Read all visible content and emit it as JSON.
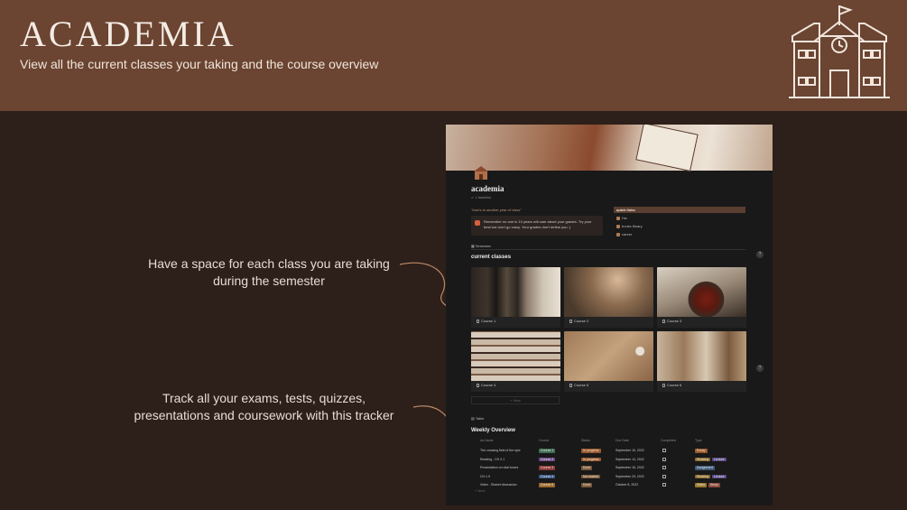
{
  "header": {
    "title": "ACADEMIA",
    "subtitle": "View all the current classes your taking and the course overview",
    "icon": "schoolhouse-icon"
  },
  "callouts": {
    "classes_line1": "Have a space for each class you are taking",
    "classes_line2": "during the semester",
    "tracker_line1": "Track all your  exams, tests, quizzes,",
    "tracker_line2": "presentations and coursework with this tracker"
  },
  "notion": {
    "page_title": "academia",
    "backlinks": "↙ 1 backlink",
    "quote": "\"how's to another year of class\"",
    "callout_text": "Remember no one in 10 years will care about your grades. Try your best but don't go crazy. Your grades don't define you :)",
    "quick_links": {
      "heading": "quick links",
      "items": [
        "Hw",
        "books library",
        "career"
      ]
    },
    "gallery_tab": "Semester",
    "current_classes_heading": "current classes",
    "help": "?",
    "classes": [
      {
        "label": "Course 1",
        "image": "books-on-shelf"
      },
      {
        "label": "Course 2",
        "image": "misty-forest-sunlight"
      },
      {
        "label": "Course 3",
        "image": "tea-and-open-book"
      },
      {
        "label": "Course 4",
        "image": "stacked-magazines"
      },
      {
        "label": "Course 5",
        "image": "pressed-flowers-paper"
      },
      {
        "label": "Course 6",
        "image": "vintage-posters"
      }
    ],
    "new_button": "+ New",
    "table_tab": "Table",
    "weekly_heading": "Weekly Overview",
    "columns": [
      "Aa Name",
      "Course",
      "Status",
      "Due Date",
      "Completed",
      "Type"
    ],
    "rows": [
      {
        "name": "The crossing field of the epic",
        "course": "Course 1",
        "course_color": "#3f6f54",
        "status": "In progress",
        "status_color": "#9a5a2e",
        "date": "September 10, 2022",
        "types": [
          {
            "t": "Essay",
            "c": "#9a5a2e"
          }
        ]
      },
      {
        "name": "Reading - CH 2.1",
        "course": "Course 2",
        "course_color": "#6a4a8a",
        "status": "In progress",
        "status_color": "#9a5a2e",
        "date": "September 14, 2022",
        "types": [
          {
            "t": "Reading",
            "c": "#8a6a2e"
          },
          {
            "t": "Lecture",
            "c": "#5a4a8a"
          }
        ]
      },
      {
        "name": "Presentation on vital forces",
        "course": "Course 3",
        "course_color": "#8a3a3a",
        "status": "Done",
        "status_color": "#7a5a3a",
        "date": "September 16, 2022",
        "types": [
          {
            "t": "Assignment",
            "c": "#3a5a7a"
          }
        ]
      },
      {
        "name": "CH 1.9",
        "course": "Course 4",
        "course_color": "#3a5a8a",
        "status": "Not started",
        "status_color": "#7a5a3a",
        "date": "September 23, 2022",
        "types": [
          {
            "t": "Reading",
            "c": "#8a6a2e"
          },
          {
            "t": "Lecture",
            "c": "#5a4a8a"
          }
        ]
      },
      {
        "name": "Video - Shared discussion",
        "course": "Course 5",
        "course_color": "#9a6a2e",
        "status": "Done",
        "status_color": "#7a5a3a",
        "date": "October 8, 2022",
        "types": [
          {
            "t": "Video",
            "c": "#9a7a2e"
          },
          {
            "t": "Study",
            "c": "#8a4a3a"
          }
        ]
      }
    ],
    "new_row": "+ New"
  }
}
